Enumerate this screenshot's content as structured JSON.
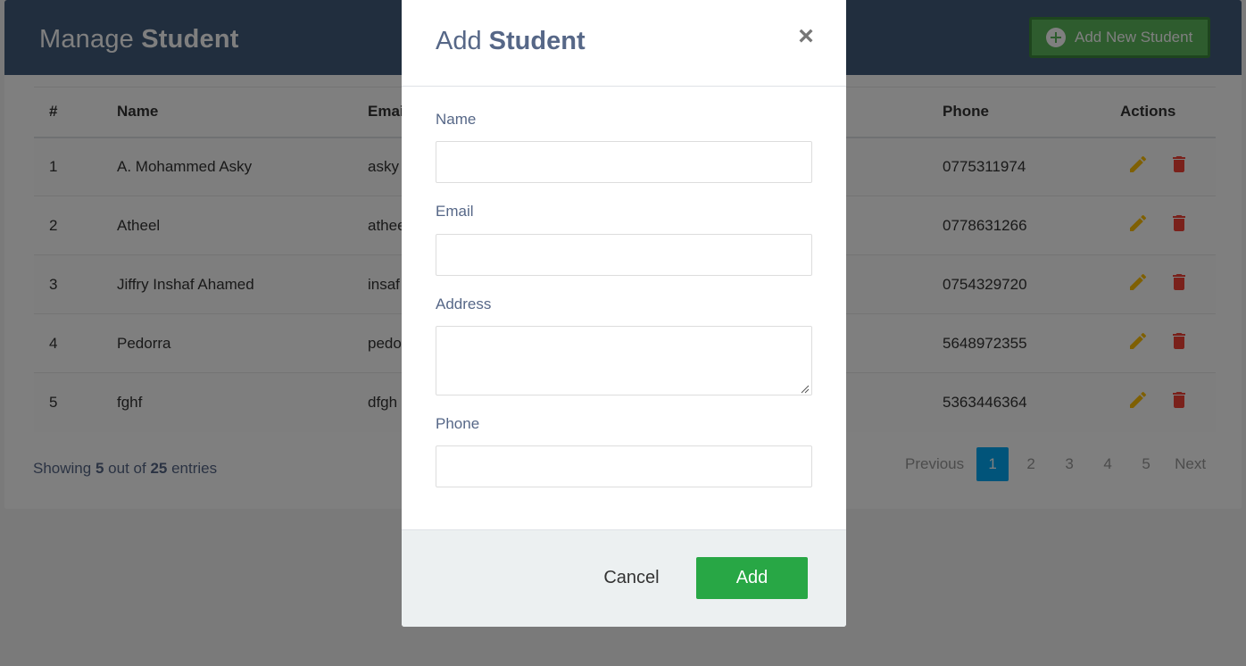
{
  "header": {
    "title_prefix": "Manage",
    "title_bold": "Student",
    "add_new_label": "Add New Student",
    "bg_color": "#435d7d"
  },
  "table": {
    "columns": [
      "#",
      "Name",
      "Email",
      "Phone",
      "Actions"
    ],
    "rows": [
      {
        "num": "1",
        "name": "A. Mohammed Asky",
        "email": "asky",
        "phone": "0775311974"
      },
      {
        "num": "2",
        "name": "Atheel",
        "email": "athee",
        "phone": "0778631266"
      },
      {
        "num": "3",
        "name": "Jiffry Inshaf Ahamed",
        "email": "insaf",
        "phone": "0754329720"
      },
      {
        "num": "4",
        "name": "Pedorra",
        "email": "pedo",
        "phone": "5648972355"
      },
      {
        "num": "5",
        "name": "fghf",
        "email": "dfgh",
        "phone": "5363446364"
      }
    ],
    "edit_icon_color": "#FFC107",
    "delete_icon_color": "#F44336"
  },
  "footer": {
    "showing_prefix": "Showing",
    "shown_count": "5",
    "out_of_text": "out of",
    "total_count": "25",
    "entries_text": "entries"
  },
  "pagination": {
    "previous": "Previous",
    "pages": [
      "1",
      "2",
      "3",
      "4",
      "5"
    ],
    "active_page": "1",
    "next": "Next"
  },
  "modal": {
    "title_prefix": "Add",
    "title_bold": "Student",
    "close_symbol": "×",
    "fields": {
      "name_label": "Name",
      "name_value": "",
      "email_label": "Email",
      "email_value": "",
      "address_label": "Address",
      "address_value": "",
      "phone_label": "Phone",
      "phone_value": ""
    },
    "cancel_label": "Cancel",
    "submit_label": "Add"
  }
}
